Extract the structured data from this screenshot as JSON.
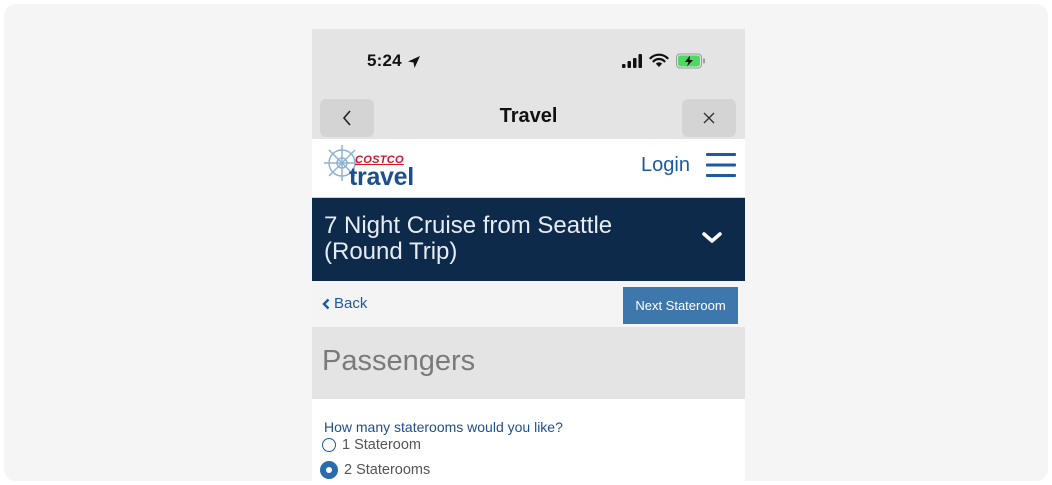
{
  "status_bar": {
    "time": "5:24",
    "icons": [
      "location-arrow-icon",
      "signal-bars-icon",
      "wifi-icon",
      "battery-charging-icon"
    ]
  },
  "nav_bar": {
    "title": "Travel",
    "back_icon": "chevron-left-icon",
    "close_icon": "close-icon"
  },
  "site_header": {
    "logo_brand": "COSTCO",
    "logo_name": "travel",
    "login_label": "Login",
    "menu_icon": "hamburger-menu-icon"
  },
  "banner": {
    "title": "7 Night Cruise from Seattle (Round Trip)",
    "expand_icon": "chevron-down-icon"
  },
  "actions": {
    "back_label": "Back",
    "next_label": "Next Stateroom"
  },
  "section": {
    "title": "Passengers"
  },
  "form": {
    "question": "How many staterooms would you like?",
    "options": [
      {
        "label": "1 Stateroom",
        "selected": false
      },
      {
        "label": "2 Staterooms",
        "selected": true
      }
    ]
  },
  "colors": {
    "banner_bg": "#0e2a4b",
    "accent_blue": "#3d77ab",
    "link_blue": "#1d5aa1",
    "brand_red": "#d1142b",
    "battery_green": "#4cd964"
  }
}
